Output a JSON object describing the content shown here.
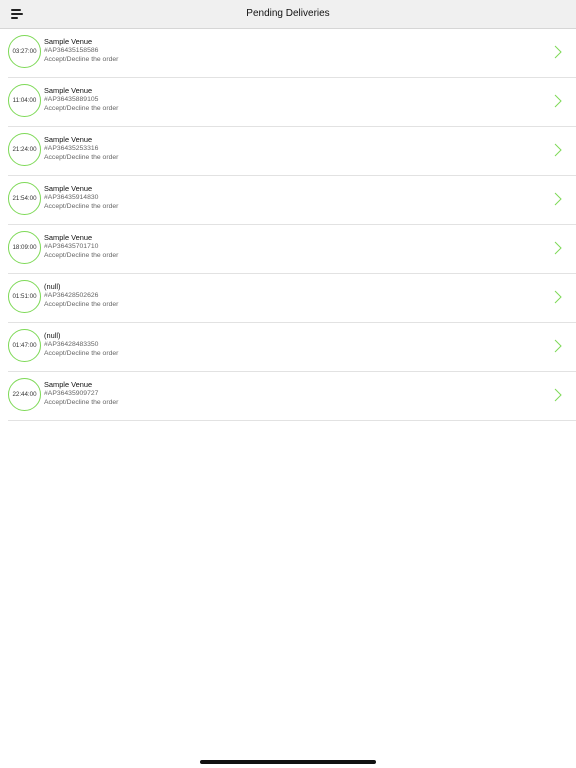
{
  "header": {
    "title": "Pending Deliveries",
    "menu_icon": "menu-icon"
  },
  "colors": {
    "accent": "#7ed957",
    "nav_background": "#f0f0f0"
  },
  "deliveries": [
    {
      "timer": "03:27:00",
      "venue": "Sample Venue",
      "order_id": "#AP36435158586",
      "action": "Accept/Decline the order"
    },
    {
      "timer": "11:04:00",
      "venue": "Sample Venue",
      "order_id": "#AP36435889105",
      "action": "Accept/Decline the order"
    },
    {
      "timer": "21:24:00",
      "venue": "Sample Venue",
      "order_id": "#AP36435253316",
      "action": "Accept/Decline the order"
    },
    {
      "timer": "21:54:00",
      "venue": "Sample Venue",
      "order_id": "#AP36435914830",
      "action": "Accept/Decline the order"
    },
    {
      "timer": "18:09:00",
      "venue": "Sample Venue",
      "order_id": "#AP36435701710",
      "action": "Accept/Decline the order"
    },
    {
      "timer": "01:51:00",
      "venue": "(null)",
      "order_id": "#AP36428502626",
      "action": "Accept/Decline the order"
    },
    {
      "timer": "01:47:00",
      "venue": "(null)",
      "order_id": "#AP36428483350",
      "action": "Accept/Decline the order"
    },
    {
      "timer": "22:44:00",
      "venue": "Sample Venue",
      "order_id": "#AP36435909727",
      "action": "Accept/Decline the order"
    }
  ]
}
